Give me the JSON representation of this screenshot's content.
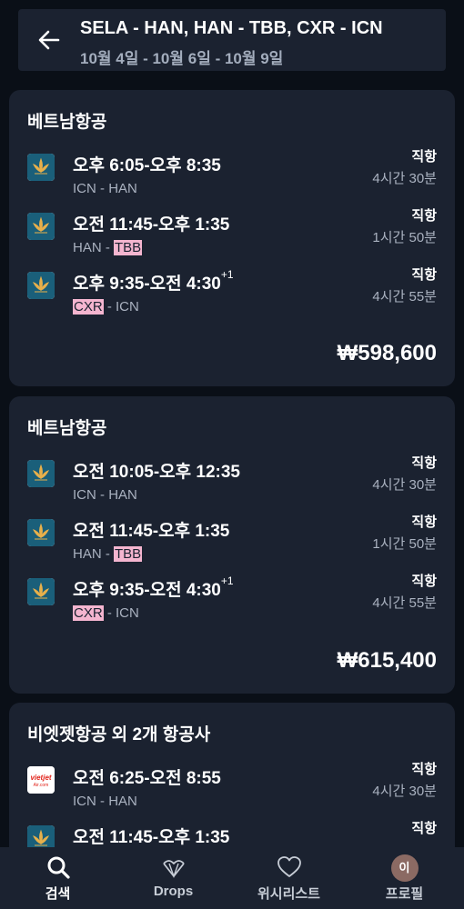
{
  "header": {
    "route": "SELA - HAN, HAN - TBB, CXR - ICN",
    "dates": "10월 4일 - 10월 6일 - 10월 9일"
  },
  "results": [
    {
      "airline": "베트남항공",
      "price": "₩598,600",
      "segments": [
        {
          "times": "오후 6:05-오후 8:35",
          "day_offset": "",
          "from": "ICN",
          "sep": " - ",
          "to": "HAN",
          "stops": "직항",
          "duration": "4시간 30분",
          "logo": "vietnam-airlines-logo"
        },
        {
          "times": "오전 11:45-오후 1:35",
          "day_offset": "",
          "from": "HAN",
          "sep": " - ",
          "to": "TBB",
          "stops": "직항",
          "duration": "1시간 50분",
          "logo": "vietnam-airlines-logo"
        },
        {
          "times": "오후 9:35-오전 4:30",
          "day_offset": "+1",
          "from": "CXR",
          "sep": " - ",
          "to": "ICN",
          "stops": "직항",
          "duration": "4시간 55분",
          "logo": "vietnam-airlines-logo"
        }
      ]
    },
    {
      "airline": "베트남항공",
      "price": "₩615,400",
      "segments": [
        {
          "times": "오전 10:05-오후 12:35",
          "day_offset": "",
          "from": "ICN",
          "sep": " - ",
          "to": "HAN",
          "stops": "직항",
          "duration": "4시간 30분",
          "logo": "vietnam-airlines-logo"
        },
        {
          "times": "오전 11:45-오후 1:35",
          "day_offset": "",
          "from": "HAN",
          "sep": " - ",
          "to": "TBB",
          "stops": "직항",
          "duration": "1시간 50분",
          "logo": "vietnam-airlines-logo"
        },
        {
          "times": "오후 9:35-오전 4:30",
          "day_offset": "+1",
          "from": "CXR",
          "sep": " - ",
          "to": "ICN",
          "stops": "직항",
          "duration": "4시간 55분",
          "logo": "vietnam-airlines-logo"
        }
      ]
    },
    {
      "airline": "비엣젯항공 외 2개 항공사",
      "segments": [
        {
          "times": "오전 6:25-오전 8:55",
          "day_offset": "",
          "from": "ICN",
          "sep": " - ",
          "to": "HAN",
          "stops": "직항",
          "duration": "4시간 30분",
          "logo": "vietjet-logo"
        },
        {
          "times": "오전 11:45-오후 1:35",
          "day_offset": "",
          "stops": "직항",
          "logo": "vietnam-airlines-logo"
        }
      ]
    }
  ],
  "nav": [
    {
      "label": "검색",
      "icon": "search-icon",
      "active": true
    },
    {
      "label": "Drops",
      "icon": "drops-icon",
      "active": false
    },
    {
      "label": "위시리스트",
      "icon": "heart-icon",
      "active": false
    },
    {
      "label": "프로필",
      "icon": "avatar",
      "active": false,
      "avatar_text": "이"
    }
  ],
  "colors": {
    "background": "#0a0f17",
    "card": "#1b2230",
    "highlight": "#f4b5cf",
    "vietnam_airlines_blue": "#1a5f7a",
    "vietnam_airlines_gold": "#e8b04b",
    "vietjet_red": "#e2231a"
  }
}
